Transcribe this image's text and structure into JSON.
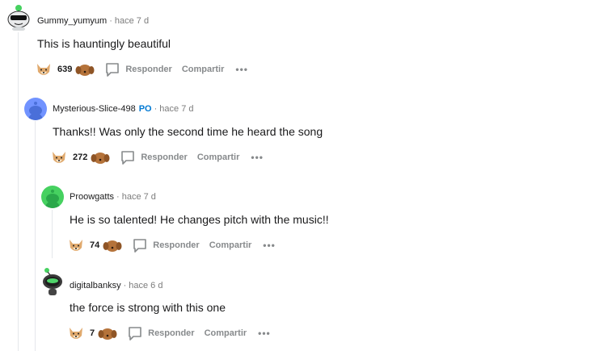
{
  "comments": [
    {
      "author": "Gummy_yumyum",
      "op_badge": "",
      "separator": "·",
      "time": "hace 7 d",
      "text": "This is hauntingly beautiful",
      "score": "639",
      "reply_label": "Responder",
      "share_label": "Compartir",
      "more_label": "•••",
      "avatar_icon": "snoo-sunglasses-avatar-icon"
    },
    {
      "author": "Mysterious-Slice-498",
      "op_badge": "PO",
      "separator": "·",
      "time": "hace 7 d",
      "text": "Thanks!! Was only the second time he heard the song",
      "score": "272",
      "reply_label": "Responder",
      "share_label": "Compartir",
      "more_label": "•••",
      "avatar_icon": "default-snoo-avatar-icon"
    },
    {
      "author": "Proowgatts",
      "op_badge": "",
      "separator": "·",
      "time": "hace 7 d",
      "text": "He is so talented! He changes pitch with the music!!",
      "score": "74",
      "reply_label": "Responder",
      "share_label": "Compartir",
      "more_label": "•••",
      "avatar_icon": "green-snoo-avatar-icon"
    },
    {
      "author": "digitalbanksy",
      "op_badge": "",
      "separator": "·",
      "time": "hace 6 d",
      "text": "the force is strong with this one",
      "score": "7",
      "reply_label": "Responder",
      "share_label": "Compartir",
      "more_label": "•••",
      "avatar_icon": "helmet-snoo-avatar-icon"
    }
  ],
  "colors": {
    "op_badge": "#0079d3",
    "meta_gray": "#7c7c7c",
    "action_gray": "#878a8c",
    "thread_line": "#e5e7eb"
  },
  "icons": {
    "upvote": "doge-upvote-icon",
    "downvote": "dog-downvote-icon",
    "reply": "speech-bubble-icon",
    "more": "ellipsis-icon"
  }
}
